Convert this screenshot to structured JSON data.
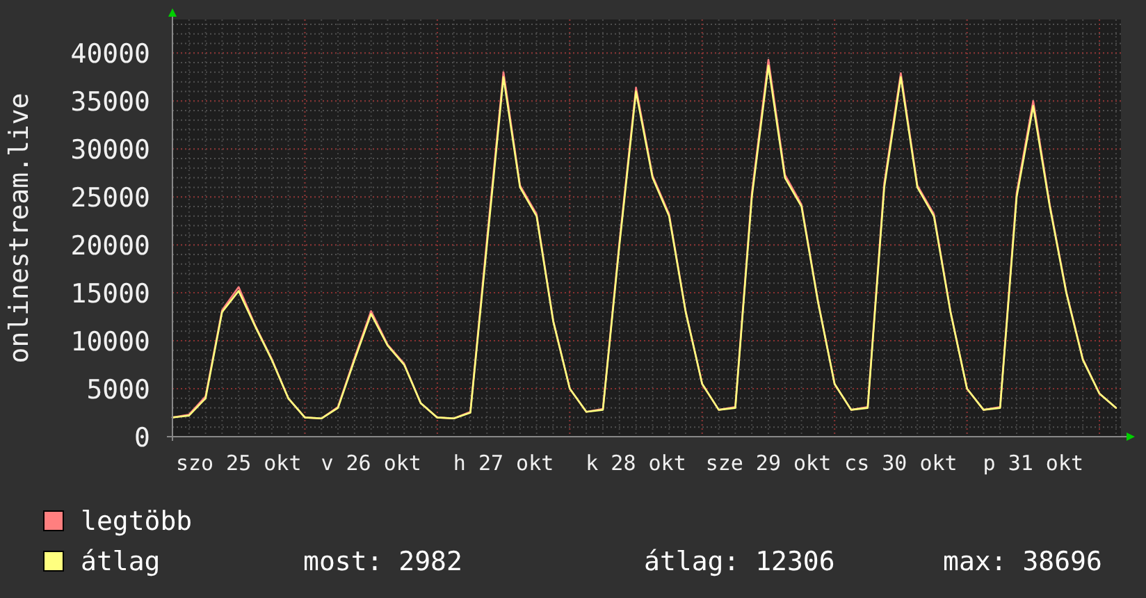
{
  "chart": {
    "chart_data": {
      "type": "line",
      "ylabel": "onlinestream.live",
      "categories": [
        null,
        null,
        null,
        null,
        "szo 25 okt",
        null,
        null,
        null,
        null,
        null,
        null,
        null,
        "v 26 okt",
        null,
        null,
        null,
        null,
        null,
        null,
        null,
        "h 27 okt",
        null,
        null,
        null,
        null,
        null,
        null,
        null,
        "k 28 okt",
        null,
        null,
        null,
        null,
        null,
        null,
        null,
        "sze 29 okt",
        null,
        null,
        null,
        null,
        null,
        null,
        null,
        "cs 30 okt",
        null,
        null,
        null,
        null,
        null,
        null,
        null,
        "p 31 okt",
        null,
        null,
        null,
        null,
        null
      ],
      "series": [
        {
          "name": "legtöbb",
          "color": "#ff7f7f",
          "values": [
            2000,
            2300,
            4200,
            13200,
            15600,
            11600,
            8100,
            4000,
            2000,
            1900,
            3100,
            8200,
            13100,
            9600,
            7600,
            3500,
            2000,
            1900,
            2600,
            20500,
            38000,
            26200,
            23200,
            12100,
            5000,
            2600,
            2900,
            20300,
            36400,
            27200,
            23200,
            13100,
            5500,
            2800,
            3100,
            25400,
            39300,
            27300,
            24200,
            14100,
            5500,
            2800,
            3100,
            26400,
            37900,
            26200,
            23200,
            13100,
            5000,
            2800,
            3100,
            25400,
            35000,
            24200,
            15100,
            8100,
            4500,
            3000
          ]
        },
        {
          "name": "átlag",
          "color": "#ffff7f",
          "values": [
            2000,
            2200,
            4000,
            13000,
            15200,
            11500,
            8000,
            4000,
            2000,
            1900,
            3000,
            8000,
            12800,
            9500,
            7500,
            3500,
            2000,
            1900,
            2500,
            20000,
            37500,
            26000,
            23000,
            12000,
            5000,
            2600,
            2800,
            20000,
            36000,
            27000,
            23000,
            13000,
            5500,
            2800,
            3000,
            25000,
            38700,
            27000,
            24000,
            14000,
            5500,
            2800,
            3000,
            26000,
            37500,
            26000,
            23000,
            13000,
            5000,
            2800,
            3000,
            25000,
            34500,
            24000,
            15000,
            8000,
            4500,
            3000
          ]
        }
      ],
      "ylim": [
        0,
        43500
      ],
      "grid": true,
      "yticks": [
        0,
        5000,
        10000,
        15000,
        20000,
        25000,
        30000,
        35000,
        40000
      ]
    }
  },
  "summary": [
    "most: 2982",
    "átlag: 12306",
    "max: 38696"
  ]
}
